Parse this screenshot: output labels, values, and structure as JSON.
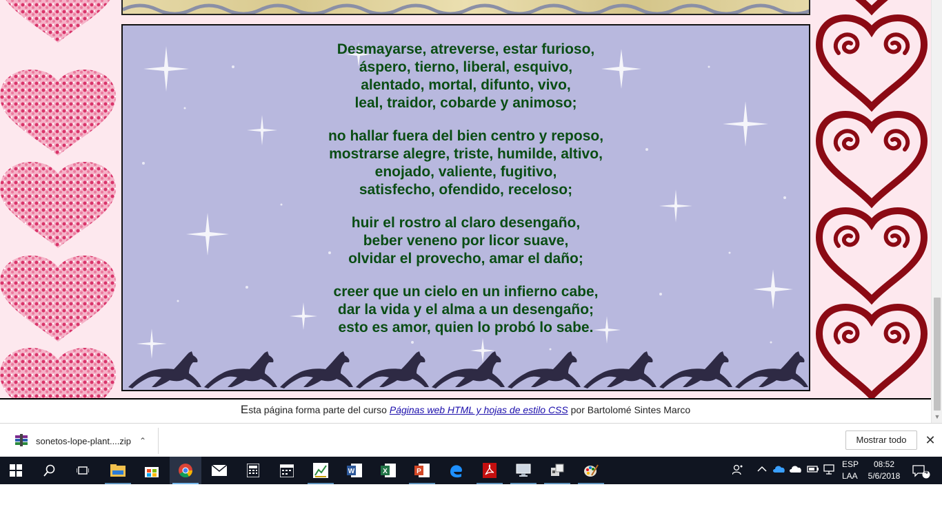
{
  "poem": {
    "stanzas": [
      [
        "Desmayarse, atreverse, estar furioso,",
        "áspero, tierno, liberal, esquivo,",
        "alentado, mortal, difunto, vivo,",
        "leal, traidor, cobarde y animoso;"
      ],
      [
        "no hallar fuera del bien centro y reposo,",
        "mostrarse alegre, triste, humilde, altivo,",
        "enojado, valiente, fugitivo,",
        "satisfecho, ofendido, receloso;"
      ],
      [
        "huir el rostro al claro desengaño,",
        "beber veneno por licor suave,",
        "olvidar el provecho, amar el daño;"
      ],
      [
        "creer que un cielo en un infierno cabe,",
        "dar la vida y el alma a un desengaño;",
        "esto es amor, quien lo probó lo sabe."
      ]
    ],
    "text_color": "#0a4d14",
    "box_color": "#b8b8de"
  },
  "footer": {
    "cap_letter": "E",
    "before_link": "sta página forma parte del curso ",
    "link_text": "Páginas web HTML y hojas de estilo CSS",
    "after_link": " por Bartolomé Sintes Marco"
  },
  "download_bar": {
    "file_name": "sonetos-lope-plant....zip",
    "show_all_label": "Mostrar todo"
  },
  "taskbar": {
    "apps": [
      "windows-start",
      "search",
      "task-view",
      "file-explorer",
      "store",
      "chrome",
      "mail",
      "calculator",
      "calendar",
      "chart-app",
      "word",
      "excel",
      "powerpoint",
      "edge",
      "acrobat",
      "monitor-app",
      "network-app",
      "paint"
    ],
    "tray": {
      "lang_top": "ESP",
      "lang_bottom": "LAA",
      "time": "08:52",
      "date": "5/6/2018",
      "notification_count": "4"
    }
  },
  "colors": {
    "heart_left": "#e04a7a",
    "heart_right": "#8b0a14",
    "page_bg": "#fde8ee"
  }
}
